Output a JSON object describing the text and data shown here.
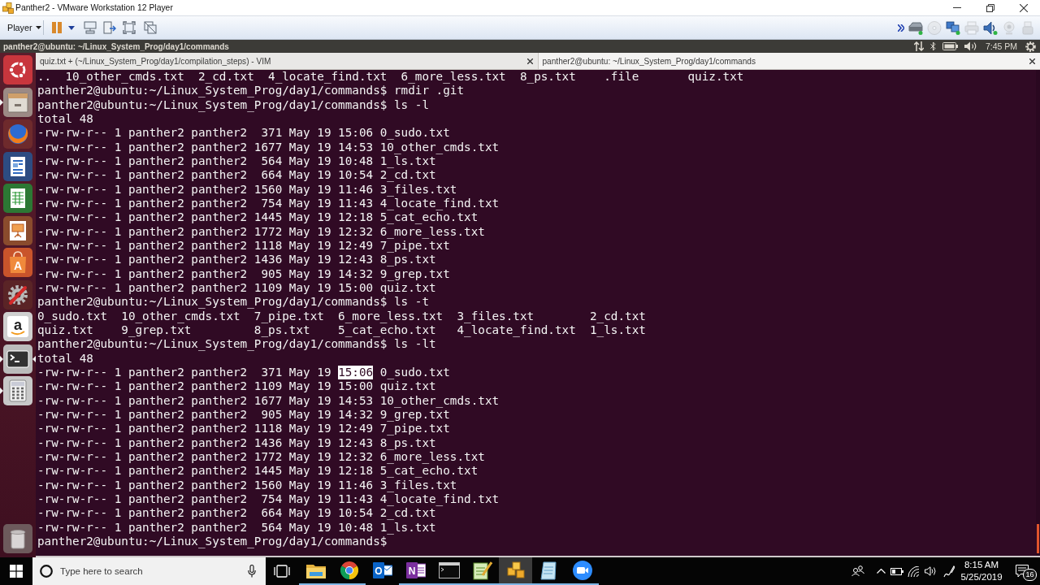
{
  "window": {
    "title": "Panther2 - VMware Workstation 12 Player"
  },
  "toolbar": {
    "menu_label": "Player",
    "devices": [
      {
        "kind": "disk",
        "connected": true
      },
      {
        "kind": "cd",
        "connected": false
      },
      {
        "kind": "network",
        "connected": true
      },
      {
        "kind": "printer",
        "connected": false
      },
      {
        "kind": "sound",
        "connected": true
      },
      {
        "kind": "camera",
        "connected": false
      },
      {
        "kind": "usb",
        "connected": false
      }
    ]
  },
  "ubuntu_panel": {
    "title": "panther2@ubuntu: ~/Linux_System_Prog/day1/commands",
    "clock": "7:45 PM"
  },
  "launcher": {
    "items": [
      {
        "kind": "dash",
        "running": false,
        "focused": false
      },
      {
        "kind": "files",
        "running": true,
        "focused": false
      },
      {
        "kind": "browser",
        "running": false,
        "focused": false
      },
      {
        "kind": "writer",
        "running": false,
        "focused": false
      },
      {
        "kind": "calc",
        "running": false,
        "focused": false
      },
      {
        "kind": "impress",
        "running": false,
        "focused": false
      },
      {
        "kind": "software",
        "glyph": "A",
        "running": false,
        "focused": false
      },
      {
        "kind": "settings",
        "running": false,
        "focused": false
      },
      {
        "kind": "shop",
        "glyph": "a",
        "running": false,
        "focused": false
      },
      {
        "kind": "terminal",
        "running": true,
        "focused": true
      },
      {
        "kind": "calculator",
        "running": true,
        "focused": false
      }
    ],
    "bottom_items": [
      {
        "kind": "trash",
        "running": false,
        "focused": false
      }
    ]
  },
  "terminal": {
    "tabs": [
      {
        "title": "quiz.txt + (~/Linux_System_Prog/day1/compilation_steps) - VIM",
        "selected": false
      },
      {
        "title": "panther2@ubuntu: ~/Linux_System_Prog/day1/commands",
        "selected": true
      }
    ],
    "lines": [
      {
        "segments": [
          {
            "text": "..  10_other_cmds.txt  2_cd.txt  4_locate_find.txt  6_more_less.txt  8_ps.txt    .file       quiz.txt",
            "selected": false
          }
        ]
      },
      {
        "segments": [
          {
            "text": "panther2@ubuntu:~/Linux_System_Prog/day1/commands$ rmdir .git",
            "selected": false
          }
        ]
      },
      {
        "segments": [
          {
            "text": "panther2@ubuntu:~/Linux_System_Prog/day1/commands$ ls -l",
            "selected": false
          }
        ]
      },
      {
        "segments": [
          {
            "text": "total 48",
            "selected": false
          }
        ]
      },
      {
        "segments": [
          {
            "text": "-rw-rw-r-- 1 panther2 panther2  371 May 19 15:06 0_sudo.txt",
            "selected": false
          }
        ]
      },
      {
        "segments": [
          {
            "text": "-rw-rw-r-- 1 panther2 panther2 1677 May 19 14:53 10_other_cmds.txt",
            "selected": false
          }
        ]
      },
      {
        "segments": [
          {
            "text": "-rw-rw-r-- 1 panther2 panther2  564 May 19 10:48 1_ls.txt",
            "selected": false
          }
        ]
      },
      {
        "segments": [
          {
            "text": "-rw-rw-r-- 1 panther2 panther2  664 May 19 10:54 2_cd.txt",
            "selected": false
          }
        ]
      },
      {
        "segments": [
          {
            "text": "-rw-rw-r-- 1 panther2 panther2 1560 May 19 11:46 3_files.txt",
            "selected": false
          }
        ]
      },
      {
        "segments": [
          {
            "text": "-rw-rw-r-- 1 panther2 panther2  754 May 19 11:43 4_locate_find.txt",
            "selected": false
          }
        ]
      },
      {
        "segments": [
          {
            "text": "-rw-rw-r-- 1 panther2 panther2 1445 May 19 12:18 5_cat_echo.txt",
            "selected": false
          }
        ]
      },
      {
        "segments": [
          {
            "text": "-rw-rw-r-- 1 panther2 panther2 1772 May 19 12:32 6_more_less.txt",
            "selected": false
          }
        ]
      },
      {
        "segments": [
          {
            "text": "-rw-rw-r-- 1 panther2 panther2 1118 May 19 12:49 7_pipe.txt",
            "selected": false
          }
        ]
      },
      {
        "segments": [
          {
            "text": "-rw-rw-r-- 1 panther2 panther2 1436 May 19 12:43 8_ps.txt",
            "selected": false
          }
        ]
      },
      {
        "segments": [
          {
            "text": "-rw-rw-r-- 1 panther2 panther2  905 May 19 14:32 9_grep.txt",
            "selected": false
          }
        ]
      },
      {
        "segments": [
          {
            "text": "-rw-rw-r-- 1 panther2 panther2 1109 May 19 15:00 quiz.txt",
            "selected": false
          }
        ]
      },
      {
        "segments": [
          {
            "text": "panther2@ubuntu:~/Linux_System_Prog/day1/commands$ ls -t",
            "selected": false
          }
        ]
      },
      {
        "segments": [
          {
            "text": "0_sudo.txt  10_other_cmds.txt  7_pipe.txt  6_more_less.txt  3_files.txt        2_cd.txt",
            "selected": false
          }
        ]
      },
      {
        "segments": [
          {
            "text": "quiz.txt    9_grep.txt         8_ps.txt    5_cat_echo.txt   4_locate_find.txt  1_ls.txt",
            "selected": false
          }
        ]
      },
      {
        "segments": [
          {
            "text": "panther2@ubuntu:~/Linux_System_Prog/day1/commands$ ls -lt",
            "selected": false
          }
        ]
      },
      {
        "segments": [
          {
            "text": "total 48",
            "selected": false
          }
        ]
      },
      {
        "segments": [
          {
            "text": "-rw-rw-r-- 1 panther2 panther2  371 May 19 ",
            "selected": false
          },
          {
            "text": "15:06",
            "selected": true
          },
          {
            "text": " 0_sudo.txt",
            "selected": false
          }
        ]
      },
      {
        "segments": [
          {
            "text": "-rw-rw-r-- 1 panther2 panther2 1109 May 19 15:00 quiz.txt",
            "selected": false
          }
        ]
      },
      {
        "segments": [
          {
            "text": "-rw-rw-r-- 1 panther2 panther2 1677 May 19 14:53 10_other_cmds.txt",
            "selected": false
          }
        ]
      },
      {
        "segments": [
          {
            "text": "-rw-rw-r-- 1 panther2 panther2  905 May 19 14:32 9_grep.txt",
            "selected": false
          }
        ]
      },
      {
        "segments": [
          {
            "text": "-rw-rw-r-- 1 panther2 panther2 1118 May 19 12:49 7_pipe.txt",
            "selected": false
          }
        ]
      },
      {
        "segments": [
          {
            "text": "-rw-rw-r-- 1 panther2 panther2 1436 May 19 12:43 8_ps.txt",
            "selected": false
          }
        ]
      },
      {
        "segments": [
          {
            "text": "-rw-rw-r-- 1 panther2 panther2 1772 May 19 12:32 6_more_less.txt",
            "selected": false
          }
        ]
      },
      {
        "segments": [
          {
            "text": "-rw-rw-r-- 1 panther2 panther2 1445 May 19 12:18 5_cat_echo.txt",
            "selected": false
          }
        ]
      },
      {
        "segments": [
          {
            "text": "-rw-rw-r-- 1 panther2 panther2 1560 May 19 11:46 3_files.txt",
            "selected": false
          }
        ]
      },
      {
        "segments": [
          {
            "text": "-rw-rw-r-- 1 panther2 panther2  754 May 19 11:43 4_locate_find.txt",
            "selected": false
          }
        ]
      },
      {
        "segments": [
          {
            "text": "-rw-rw-r-- 1 panther2 panther2  664 May 19 10:54 2_cd.txt",
            "selected": false
          }
        ]
      },
      {
        "segments": [
          {
            "text": "-rw-rw-r-- 1 panther2 panther2  564 May 19 10:48 1_ls.txt",
            "selected": false
          }
        ]
      },
      {
        "segments": [
          {
            "text": "panther2@ubuntu:~/Linux_System_Prog/day1/commands$ ",
            "selected": false
          }
        ]
      }
    ]
  },
  "taskbar": {
    "search": {
      "placeholder": "Type here to search"
    },
    "apps": [
      {
        "kind": "explorer",
        "running": true,
        "selected": false
      },
      {
        "kind": "chrome",
        "running": true,
        "selected": false
      },
      {
        "kind": "outlook",
        "glyph": "O",
        "running": false,
        "selected": false
      },
      {
        "kind": "onenote",
        "glyph": "N",
        "running": true,
        "selected": false
      },
      {
        "kind": "console",
        "running": true,
        "selected": false
      },
      {
        "kind": "notepad_pencil",
        "running": true,
        "selected": false
      },
      {
        "kind": "vmware",
        "running": true,
        "selected": true
      },
      {
        "kind": "notepad",
        "running": true,
        "selected": false
      },
      {
        "kind": "zoom",
        "running": true,
        "selected": false
      }
    ],
    "clock": {
      "time": "8:15 AM",
      "date": "5/25/2019"
    },
    "notifications": {
      "count": "16"
    }
  }
}
